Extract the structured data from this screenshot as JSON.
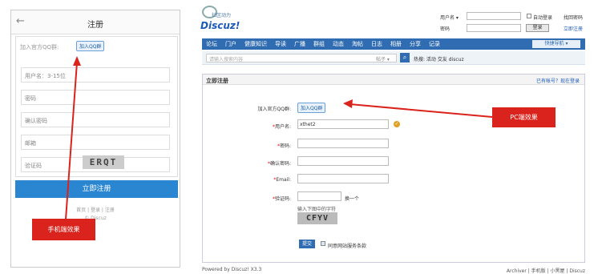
{
  "mobile": {
    "back_glyph": "←",
    "title": "注册",
    "qq_label": "加入官方QQ群:",
    "qq_button": "加入QQ群",
    "username_placeholder": "用户名：3-15位",
    "password_placeholder": "密码",
    "confirm_placeholder": "确认密码",
    "email_placeholder": "邮箱",
    "captcha_placeholder": "验证码",
    "captcha_text": "ERQT",
    "submit": "立即注册",
    "links": "首页 | 登录 | 注册",
    "copyright": "© Discuz",
    "annotation": "手机端效果"
  },
  "pc": {
    "logo_cn": "社区动力",
    "logo_en": "Discuz!",
    "top": {
      "username_label": "用户名 ▾",
      "password_label": "密码",
      "auto_login": "自动登录",
      "forgot": "找回密码",
      "login_button": "登录",
      "register_link": "立即注册"
    },
    "nav": [
      "论坛",
      "门户",
      "健康知识",
      "导读",
      "广播",
      "群组",
      "动态",
      "淘帖",
      "日志",
      "相册",
      "分享",
      "记录"
    ],
    "nav_quick": "快捷导航 ▾",
    "search": {
      "placeholder": "请输入搜索内容",
      "select": "帖子 ▾",
      "hot": "热搜: 活动 交友 discuz"
    },
    "panel": {
      "title": "立即注册",
      "login_link": "已有帐号？现在登录",
      "qq_label": "加入官方QQ群:",
      "qq_button": "加入QQ群",
      "username_label": "用户名:",
      "username_value": "xthet2",
      "password_label": "密码:",
      "confirm_label": "确认密码:",
      "email_label": "Email:",
      "captcha_label": "验证码:",
      "captcha_change": "换一个",
      "captcha_hint": "输入下图中的字符",
      "captcha_text": "CFYV",
      "submit": "提交",
      "agree": "同意网站服务条款"
    },
    "footer_left": "Powered by Discuz! X3.3",
    "footer_right": "Archiver | 手机版 | 小黑屋 | Discuz",
    "annotation": "PC端效果"
  },
  "colors": {
    "accent": "#2f6cb1",
    "annotation": "#d9231c",
    "mobile_submit": "#2a86d0"
  }
}
